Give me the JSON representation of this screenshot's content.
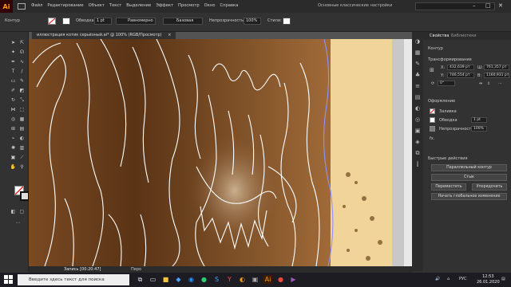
{
  "menubar": {
    "logo": "Ai",
    "items": [
      "Файл",
      "Редактирование",
      "Объект",
      "Текст",
      "Выделение",
      "Эффект",
      "Просмотр",
      "Окно",
      "Справка"
    ],
    "workspace": "Основные классические настройки",
    "window_controls": [
      "–",
      "□",
      "✕"
    ]
  },
  "control_bar": {
    "label": "Контур",
    "stroke_label": "Обводка:",
    "stroke_value": "1 pt",
    "profile": "Равномерно",
    "brush": "Базовая",
    "opacity_label": "Непрозрачность:",
    "opacity_value": "100%",
    "styles_label": "Стили:"
  },
  "document_tab": {
    "title": "иллюстрация котик серьёзный.ai* @ 100% (RGB/Просмотр)",
    "close": "×"
  },
  "statusbar": {
    "recording": "Запись [00:20:47]",
    "selection_tool": "Перо"
  },
  "panel": {
    "tabs": [
      "Свойства",
      "Библиотеки"
    ],
    "section_path": "Контур",
    "section_transform": "Трансформирование",
    "x_label": "X:",
    "x_value": "432,639 рт",
    "y_label": "Y:",
    "y_value": "746,554 рт",
    "w_label": "Ш:",
    "w_value": "761,357 рт",
    "h_label": "В:",
    "h_value": "1160,931 рт",
    "angle_value": "0°",
    "section_appearance": "Оформление",
    "fill_label": "Заливка",
    "stroke_label": "Обводка",
    "stroke_value": "1 pt",
    "opacity_label": "Непрозрачность",
    "opacity_value": "100%",
    "fx": "fx.",
    "section_quick": "Быстрые действия",
    "btn_offset": "Параллельный контур",
    "btn_simplify": "Стык",
    "btn_arrange": "Переместить",
    "btn_align": "Упорядочить",
    "btn_global_edit": "Начать глобальное изменение"
  },
  "taskbar": {
    "search_placeholder": "Введите здесь текст для поиска",
    "time": "12:53",
    "date": "26.01.2020",
    "lang": "РУС"
  },
  "colors": {
    "accent": "#ff9a00",
    "fur_dark": "#5a3416",
    "fur_mid": "#8a5a2e",
    "paper": "#f0d49a"
  }
}
